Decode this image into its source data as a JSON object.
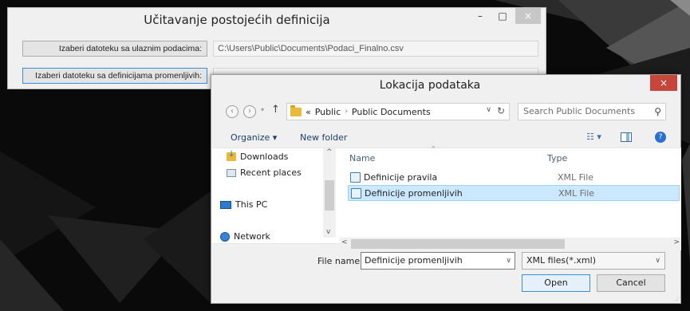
{
  "main_window": {
    "title": "Učitavanje postojećih definicija",
    "controls": {
      "minimize": "–",
      "maximize": "□",
      "close": "×"
    },
    "rows": [
      {
        "button_label": "Izaberi datoteku sa ulaznim podacima:",
        "field_value": "C:\\Users\\Public\\Documents\\Podaci_Finalno.csv"
      },
      {
        "button_label": "Izaberi datoteku sa definicijama promenljivih:",
        "field_value": ""
      }
    ]
  },
  "dialog": {
    "title": "Lokacija podataka",
    "close": "×",
    "nav": {
      "back": "‹",
      "forward": "›",
      "dropdown": "▾",
      "up": "↑"
    },
    "address": {
      "prefix": "«",
      "parts": [
        "Public",
        "Public Documents"
      ],
      "separator": "›",
      "dropdown": "∨",
      "refresh": "↻"
    },
    "search": {
      "placeholder": "Search Public Documents",
      "icon": "⚲"
    },
    "toolbar": {
      "organize": "Organize ▾",
      "new_folder": "New folder",
      "view": "☷ ▾",
      "help": "?"
    },
    "nav_pane": {
      "items": [
        "Downloads",
        "Recent places",
        "This PC",
        "Network"
      ],
      "scroll_up": "^",
      "scroll_down": "v"
    },
    "columns": {
      "name": "Name",
      "type": "Type",
      "sort": "^"
    },
    "files": [
      {
        "name": "Definicije pravila",
        "type": "XML File",
        "selected": false
      },
      {
        "name": "Definicije promenljivih",
        "type": "XML File",
        "selected": true
      }
    ],
    "hscroll": {
      "left": "<",
      "right": ">"
    },
    "filename": {
      "label": "File name:",
      "value": "Definicije promenljivih",
      "dropdown": "∨"
    },
    "filter": {
      "value": "XML files(*.xml)",
      "dropdown": "∨"
    },
    "buttons": {
      "open": "Open",
      "cancel": "Cancel"
    },
    "grip": ".:"
  },
  "colors": {
    "selection": "#cce8ff",
    "close_red": "#c7463b",
    "folder": "#e8b93a",
    "link_blue": "#1e3d6e"
  }
}
